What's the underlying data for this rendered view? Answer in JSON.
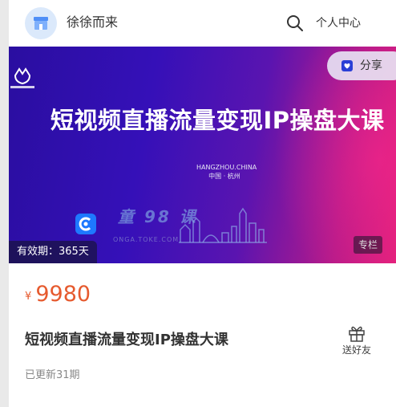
{
  "header": {
    "shop_name": "徐徐而来",
    "personal_center_label": "个人中心",
    "search_icon": "search-icon",
    "avatar_icon": "shop-icon"
  },
  "banner": {
    "title": "短视频直播流量变现IP操盘大课",
    "city_en": "HANGZHOU.CHINA",
    "city_cn": "中国 · 杭州",
    "share_label": "分享",
    "watermark_text": "童 98 课",
    "watermark_url": "ONGA.TOKE.COM",
    "validity": "有效期：365天",
    "column_badge": "专栏"
  },
  "product": {
    "currency_symbol": "¥",
    "price": "9980",
    "title": "短视频直播流量变现IP操盘大课",
    "gift_label": "送好友",
    "update_status": "已更新31期"
  },
  "colors": {
    "price": "#e65a2e",
    "banner_start": "#2a0ea0",
    "banner_end": "#e0207a"
  }
}
